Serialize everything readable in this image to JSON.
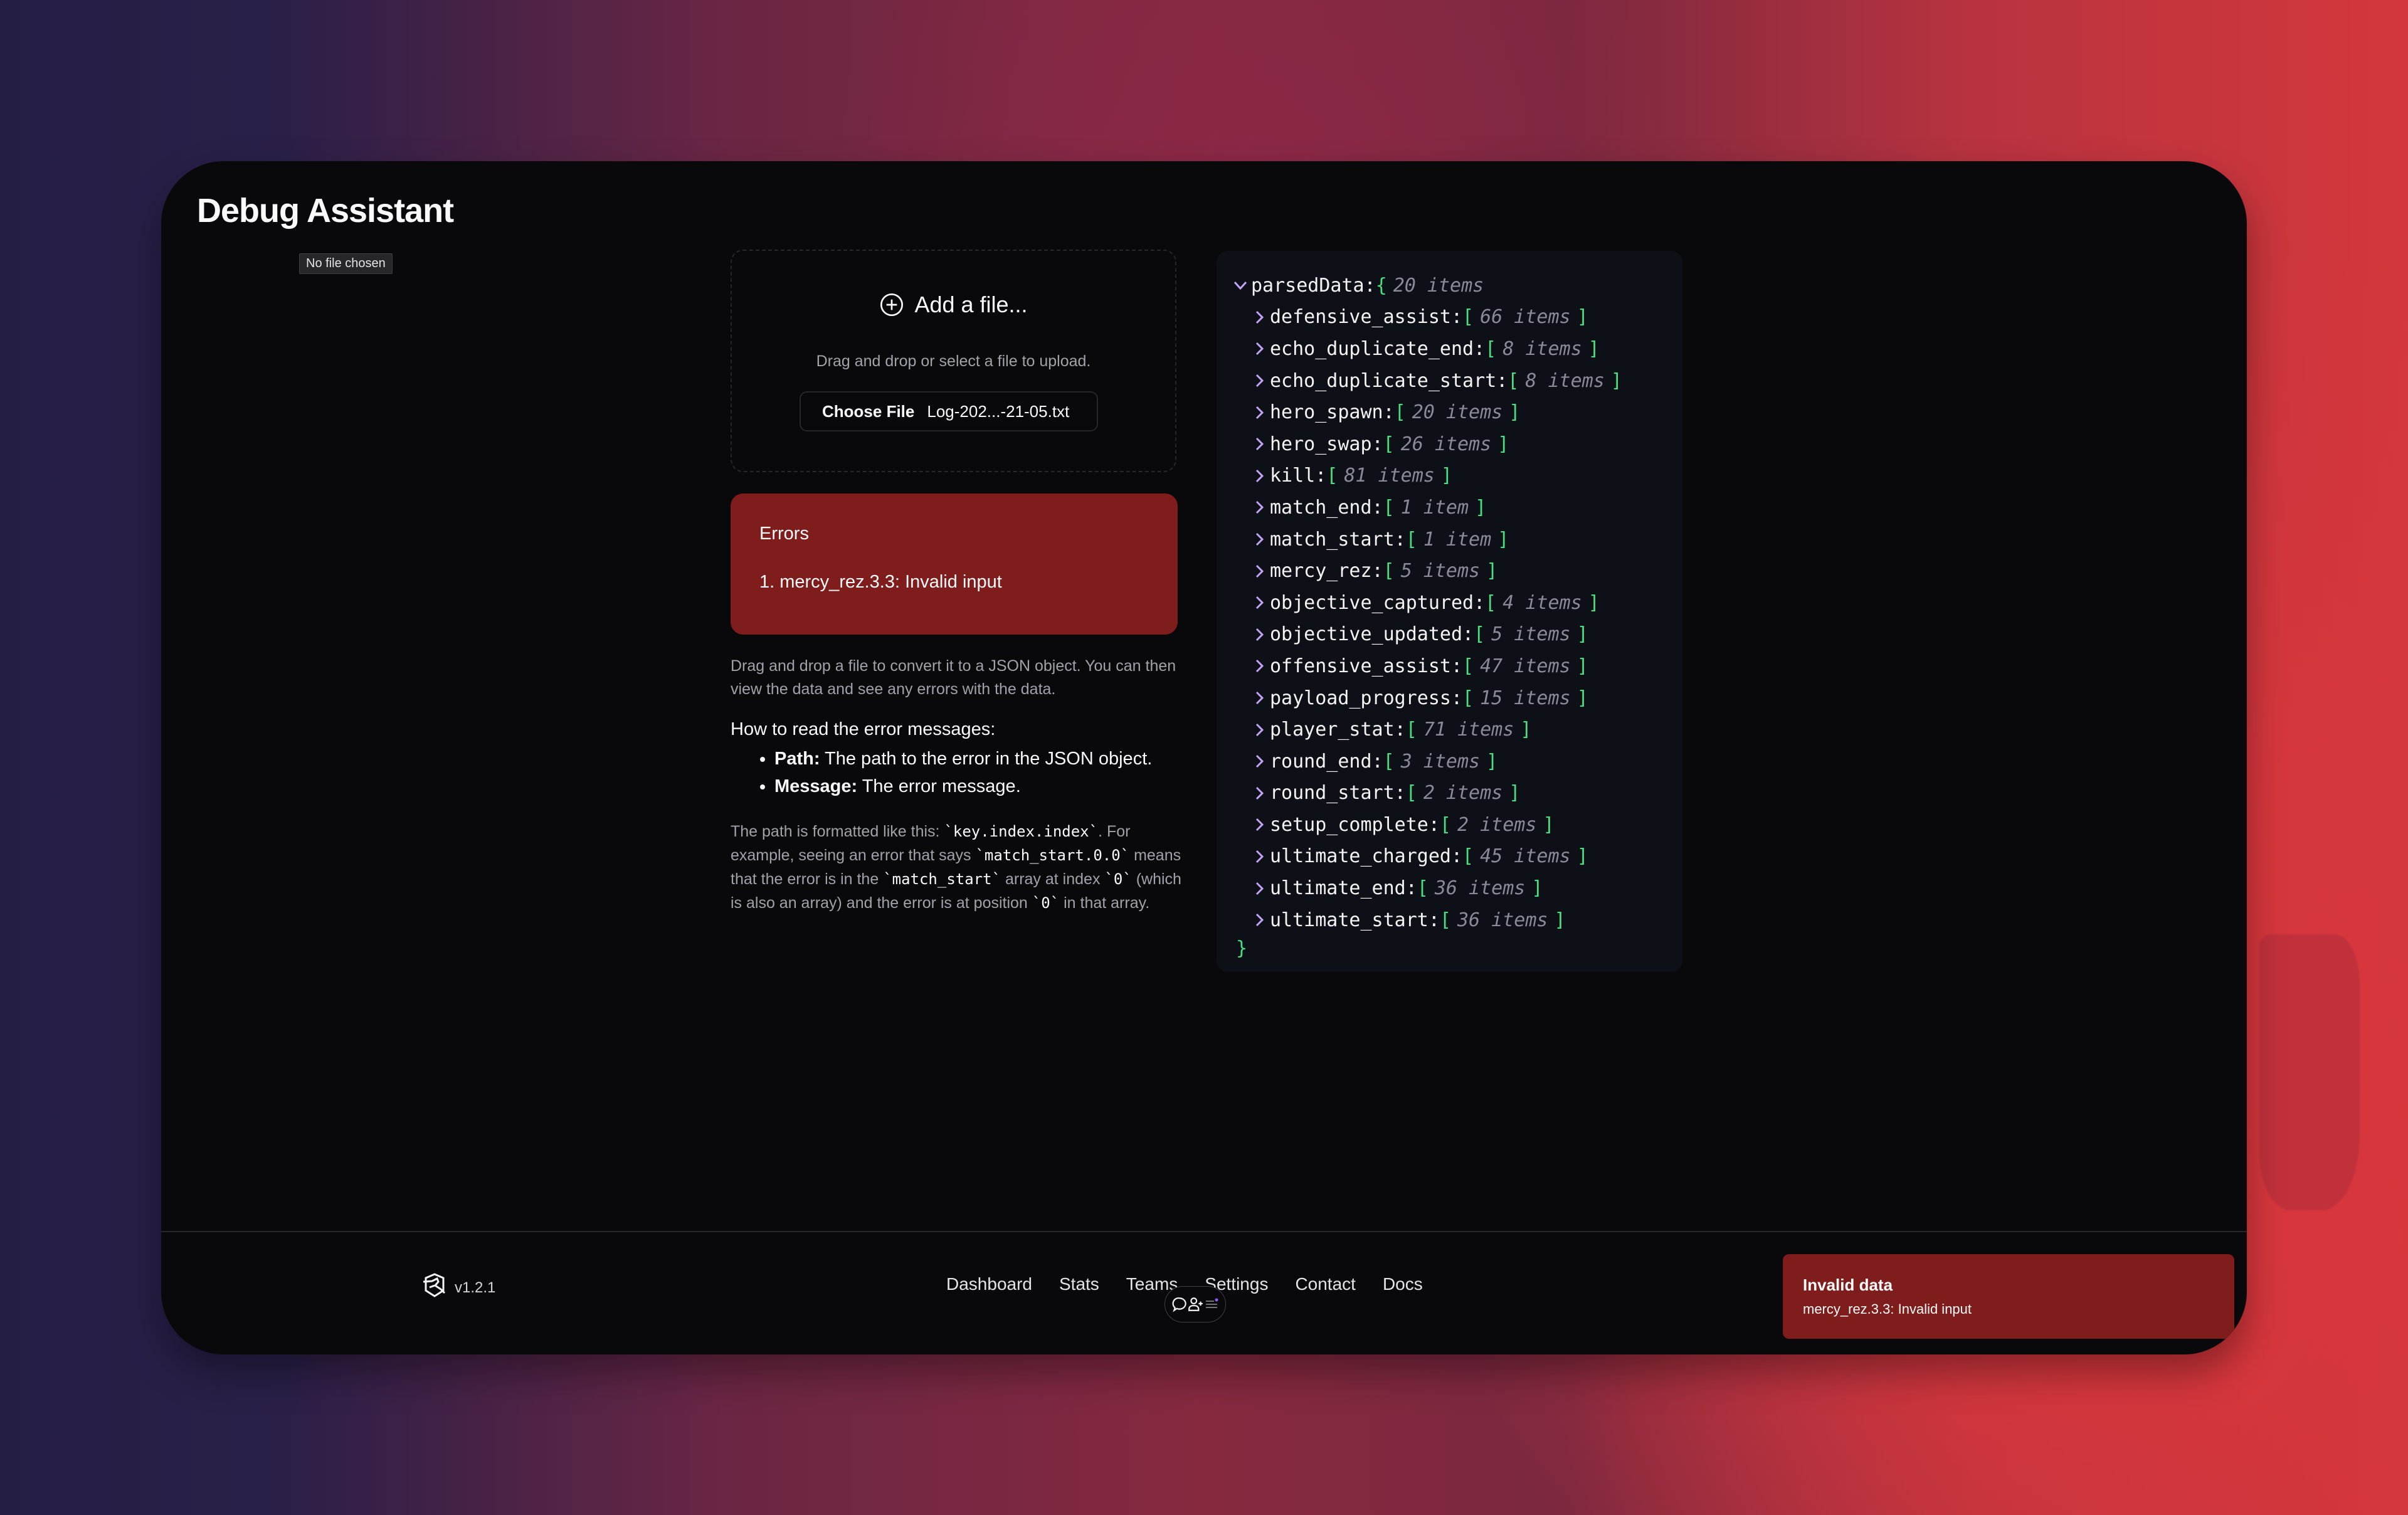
{
  "app": {
    "title": "Debug Assistant",
    "file_tooltip": "No file chosen"
  },
  "upload": {
    "add_label": "Add a file...",
    "hint": "Drag and drop or select a file to upload.",
    "choose_button": "Choose File",
    "selected_file": "Log-202...-21-05.txt"
  },
  "errors": {
    "heading": "Errors",
    "items": [
      "1. mercy_rez.3.3: Invalid input"
    ]
  },
  "help": {
    "description": "Drag and drop a file to convert it to a JSON object. You can then view the data and see any errors with the data.",
    "howto_title": "How to read the error messages:",
    "bullets": [
      {
        "label": "Path:",
        "text": " The path to the error in the JSON object."
      },
      {
        "label": "Message:",
        "text": " The error message."
      }
    ],
    "path_info": {
      "t1": "The path is formatted like this: ",
      "c1": "`key.index.index`",
      "t2": ". For example, seeing an error that says ",
      "c2": "`match_start.0.0`",
      "t3": " means that the error is in the ",
      "c3": "`match_start`",
      "t4": " array at index ",
      "c4": "`0`",
      "t5": " (which is also an array) and the error is at position ",
      "c5": "`0`",
      "t6": " in that array."
    }
  },
  "json_tree": {
    "root_key": "parsedData",
    "root_open": "{",
    "root_count": "20 items",
    "root_close": "}",
    "entries": [
      {
        "key": "defensive_assist",
        "count": "66 items"
      },
      {
        "key": "echo_duplicate_end",
        "count": "8 items"
      },
      {
        "key": "echo_duplicate_start",
        "count": "8 items"
      },
      {
        "key": "hero_spawn",
        "count": "20 items"
      },
      {
        "key": "hero_swap",
        "count": "26 items"
      },
      {
        "key": "kill",
        "count": "81 items"
      },
      {
        "key": "match_end",
        "count": "1 item"
      },
      {
        "key": "match_start",
        "count": "1 item"
      },
      {
        "key": "mercy_rez",
        "count": "5 items"
      },
      {
        "key": "objective_captured",
        "count": "4 items"
      },
      {
        "key": "objective_updated",
        "count": "5 items"
      },
      {
        "key": "offensive_assist",
        "count": "47 items"
      },
      {
        "key": "payload_progress",
        "count": "15 items"
      },
      {
        "key": "player_stat",
        "count": "71 items"
      },
      {
        "key": "round_end",
        "count": "3 items"
      },
      {
        "key": "round_start",
        "count": "2 items"
      },
      {
        "key": "setup_complete",
        "count": "2 items"
      },
      {
        "key": "ultimate_charged",
        "count": "45 items"
      },
      {
        "key": "ultimate_end",
        "count": "36 items"
      },
      {
        "key": "ultimate_start",
        "count": "36 items"
      }
    ]
  },
  "footer": {
    "version": "v1.2.1",
    "nav": [
      "Dashboard",
      "Stats",
      "Teams",
      "Settings",
      "Contact",
      "Docs"
    ]
  },
  "floating_toolbar": {
    "icons": [
      "comment-icon",
      "add-user-icon",
      "menu-icon"
    ]
  },
  "toast": {
    "title": "Invalid data",
    "message": "mercy_rez.3.3: Invalid input"
  },
  "colors": {
    "error_bg": "#7f1d1d",
    "window_bg": "#09090b",
    "json_bracket": "#4ade80",
    "json_chevron": "#c4a5f5"
  }
}
